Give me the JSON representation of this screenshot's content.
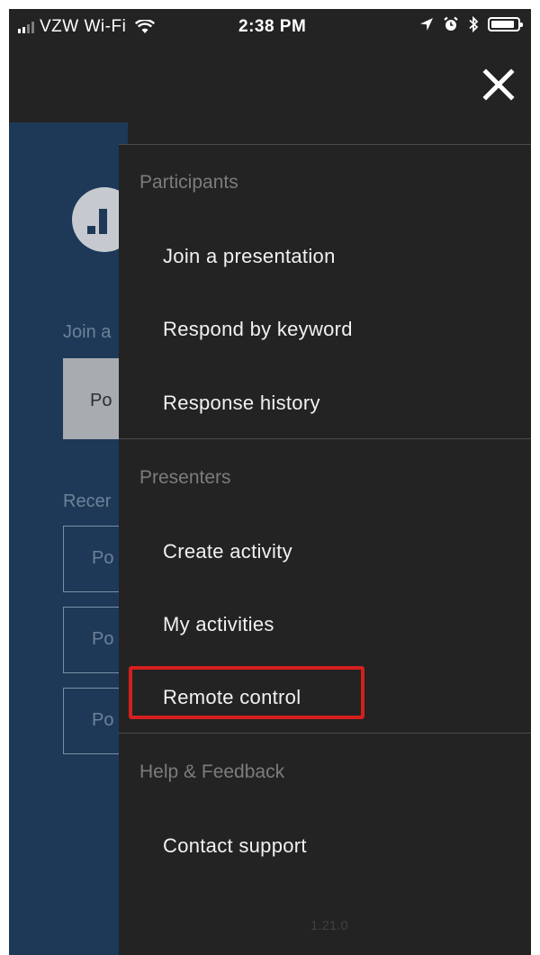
{
  "status_bar": {
    "carrier": "VZW Wi-Fi",
    "time": "2:38 PM",
    "battery_level_percent": 88,
    "icons": [
      "signal-icon",
      "wifi-icon",
      "location-arrow-icon",
      "alarm-icon",
      "bluetooth-icon",
      "battery-icon"
    ]
  },
  "background_app": {
    "join_label": "Join a",
    "input_value": "Po",
    "recent_label": "Recer",
    "recent_items": [
      "Po",
      "Po",
      "Po"
    ]
  },
  "menu": {
    "close_icon": "close-icon",
    "sections": [
      {
        "title": "Participants",
        "items": [
          "Join a presentation",
          "Respond by keyword",
          "Response history"
        ]
      },
      {
        "title": "Presenters",
        "items": [
          "Create activity",
          "My activities",
          "Remote control"
        ]
      },
      {
        "title": "Help & Feedback",
        "items": [
          "Contact support"
        ]
      }
    ],
    "highlighted_item": "Remote control",
    "highlight_color": "#d41f1f",
    "version": "1.21.0"
  },
  "colors": {
    "menu_background": "#232323",
    "app_background": "#1d3957",
    "section_title": "#7c7c7c",
    "menu_text": "#f1f1f1"
  }
}
